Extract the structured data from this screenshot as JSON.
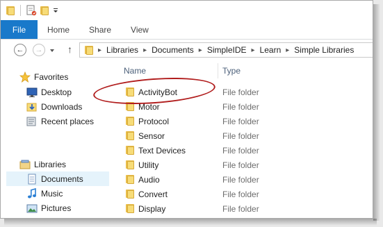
{
  "ribbon": {
    "tabs": [
      "File",
      "Home",
      "Share",
      "View"
    ]
  },
  "address_bar": {
    "crumbs": [
      "Libraries",
      "Documents",
      "SimpleIDE",
      "Learn",
      "Simple Libraries"
    ]
  },
  "navigation": {
    "favorites_label": "Favorites",
    "favorites": [
      "Desktop",
      "Downloads",
      "Recent places"
    ],
    "libraries_label": "Libraries",
    "libraries": [
      "Documents",
      "Music",
      "Pictures"
    ],
    "selected": "Documents"
  },
  "file_list": {
    "columns": {
      "name": "Name",
      "type": "Type"
    },
    "rows": [
      {
        "name": "ActivityBot",
        "type": "File folder"
      },
      {
        "name": "Motor",
        "type": "File folder"
      },
      {
        "name": "Protocol",
        "type": "File folder"
      },
      {
        "name": "Sensor",
        "type": "File folder"
      },
      {
        "name": "Text Devices",
        "type": "File folder"
      },
      {
        "name": "Utility",
        "type": "File folder"
      },
      {
        "name": "Audio",
        "type": "File folder"
      },
      {
        "name": "Convert",
        "type": "File folder"
      },
      {
        "name": "Display",
        "type": "File folder"
      }
    ]
  },
  "annotation": {
    "highlighted_item": "ActivityBot",
    "color": "#b11d1d"
  },
  "colors": {
    "file_tab": "#1979ca",
    "selection": "#e5f3fb",
    "folder": "#f7dc78"
  }
}
